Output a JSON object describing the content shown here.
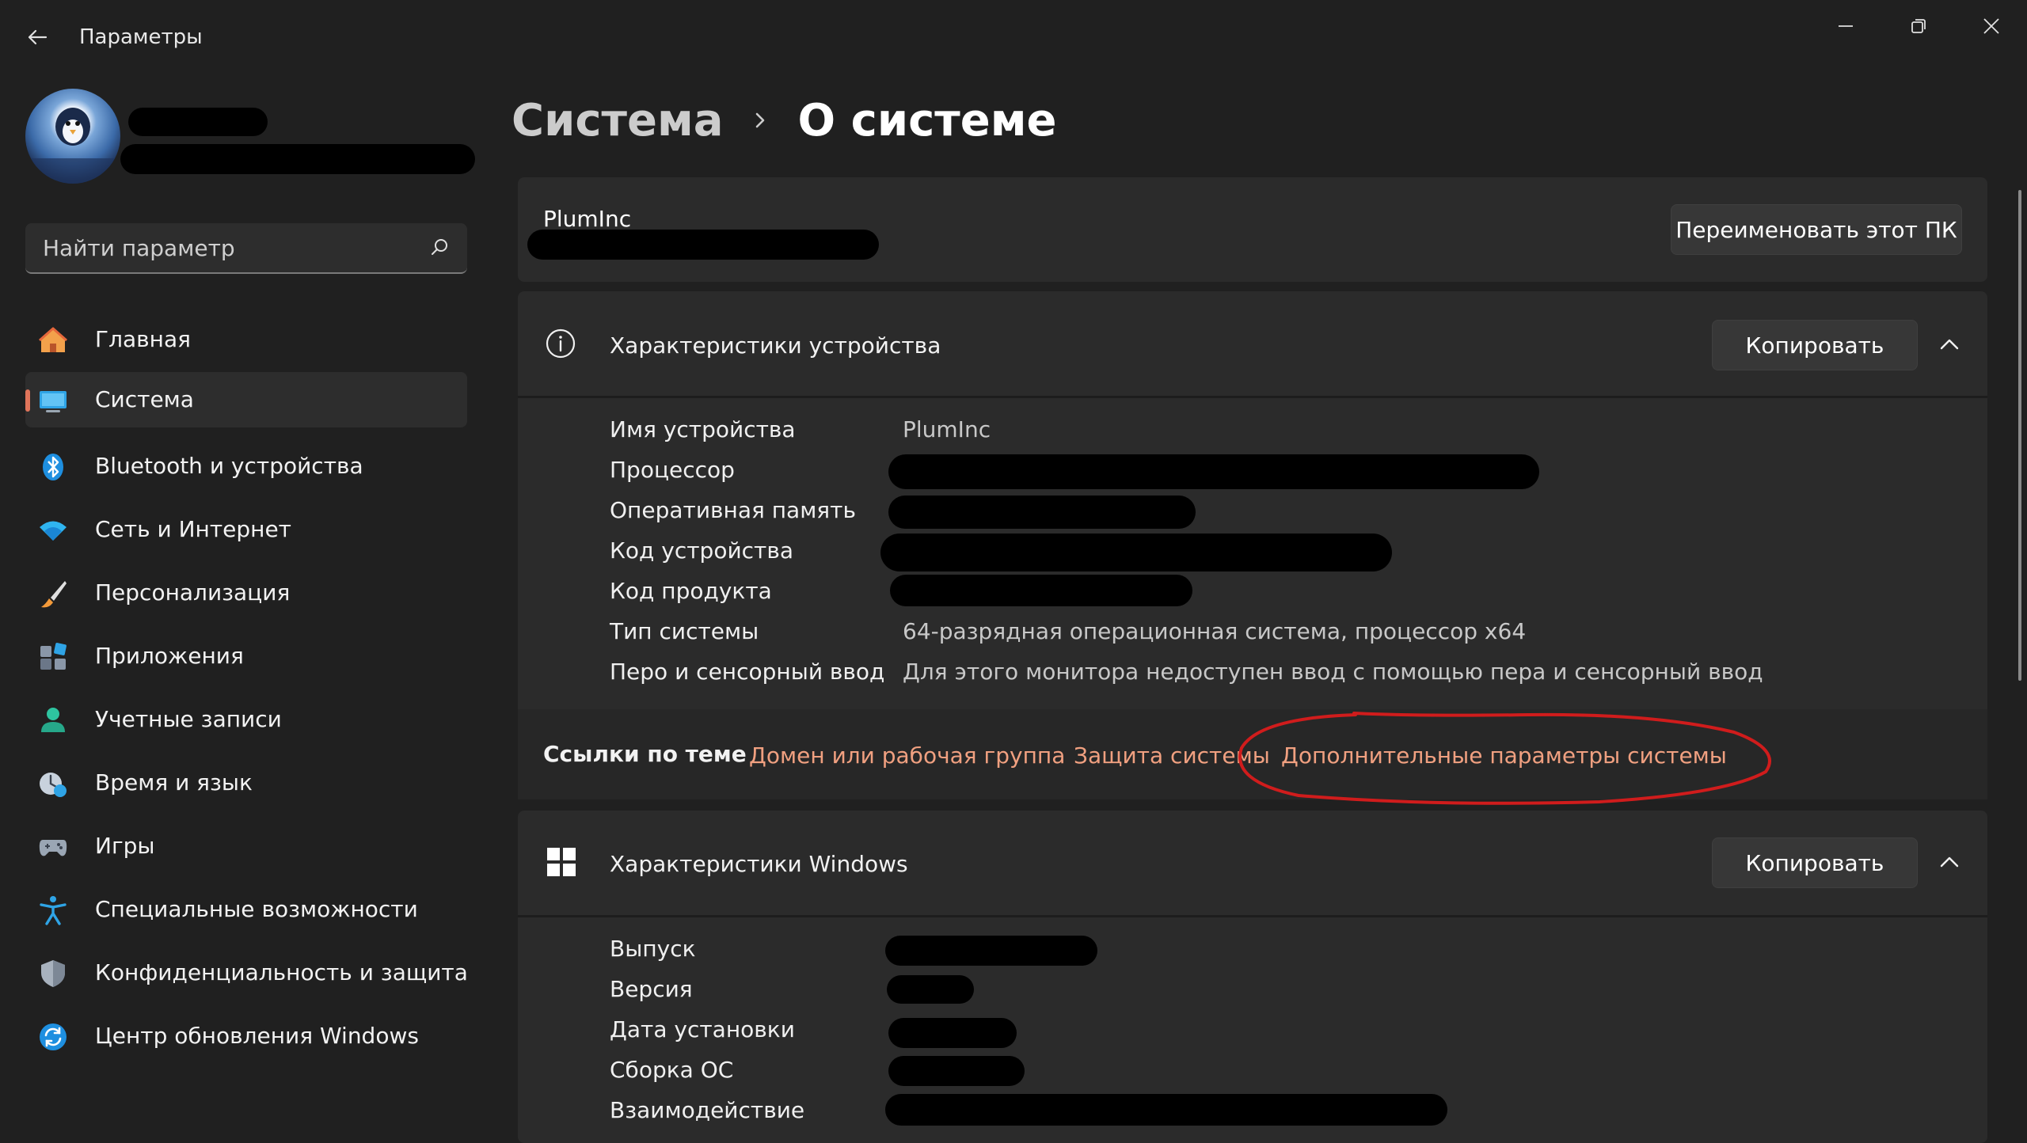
{
  "window": {
    "title": "Параметры"
  },
  "search": {
    "placeholder": "Найти параметр"
  },
  "sidebar": {
    "items": [
      {
        "label": "Главная",
        "icon": "home-icon"
      },
      {
        "label": "Система",
        "icon": "monitor-icon",
        "selected": true
      },
      {
        "label": "Bluetooth и устройства",
        "icon": "bluetooth-icon"
      },
      {
        "label": "Сеть и Интернет",
        "icon": "wifi-icon"
      },
      {
        "label": "Персонализация",
        "icon": "brush-icon"
      },
      {
        "label": "Приложения",
        "icon": "apps-icon"
      },
      {
        "label": "Учетные записи",
        "icon": "user-icon"
      },
      {
        "label": "Время и язык",
        "icon": "clock-globe-icon"
      },
      {
        "label": "Игры",
        "icon": "gamepad-icon"
      },
      {
        "label": "Специальные возможности",
        "icon": "accessibility-icon"
      },
      {
        "label": "Конфиденциальность и защита",
        "icon": "shield-icon"
      },
      {
        "label": "Центр обновления Windows",
        "icon": "update-icon"
      }
    ]
  },
  "breadcrumb": {
    "parent": "Система",
    "current": "О системе"
  },
  "pc_card": {
    "name": "PlumInc",
    "rename_button": "Переименовать этот ПК"
  },
  "device_specs": {
    "title": "Характеристики устройства",
    "copy_button": "Копировать",
    "rows": [
      {
        "label": "Имя устройства",
        "value": "PlumInc"
      },
      {
        "label": "Процессор",
        "value": ""
      },
      {
        "label": "Оперативная память",
        "value": ""
      },
      {
        "label": "Код устройства",
        "value": ""
      },
      {
        "label": "Код продукта",
        "value": ""
      },
      {
        "label": "Тип системы",
        "value": "64-разрядная операционная система, процессор x64"
      },
      {
        "label": "Перо и сенсорный ввод",
        "value": "Для этого монитора недоступен ввод с помощью пера и сенсорный ввод"
      }
    ]
  },
  "related_links": {
    "title": "Ссылки по теме",
    "links": [
      "Домен или рабочая группа",
      "Защита системы",
      "Дополнительные параметры системы"
    ]
  },
  "windows_specs": {
    "title": "Характеристики Windows",
    "copy_button": "Копировать",
    "rows": [
      {
        "label": "Выпуск",
        "value": ""
      },
      {
        "label": "Версия",
        "value": ""
      },
      {
        "label": "Дата установки",
        "value": ""
      },
      {
        "label": "Сборка ОС",
        "value": ""
      },
      {
        "label": "Взаимодействие",
        "value": ""
      }
    ]
  },
  "colors": {
    "background": "#202020",
    "card": "#2b2b2b",
    "accent": "#e0745a",
    "link": "#f0a080",
    "annotation": "#d01c1c"
  }
}
